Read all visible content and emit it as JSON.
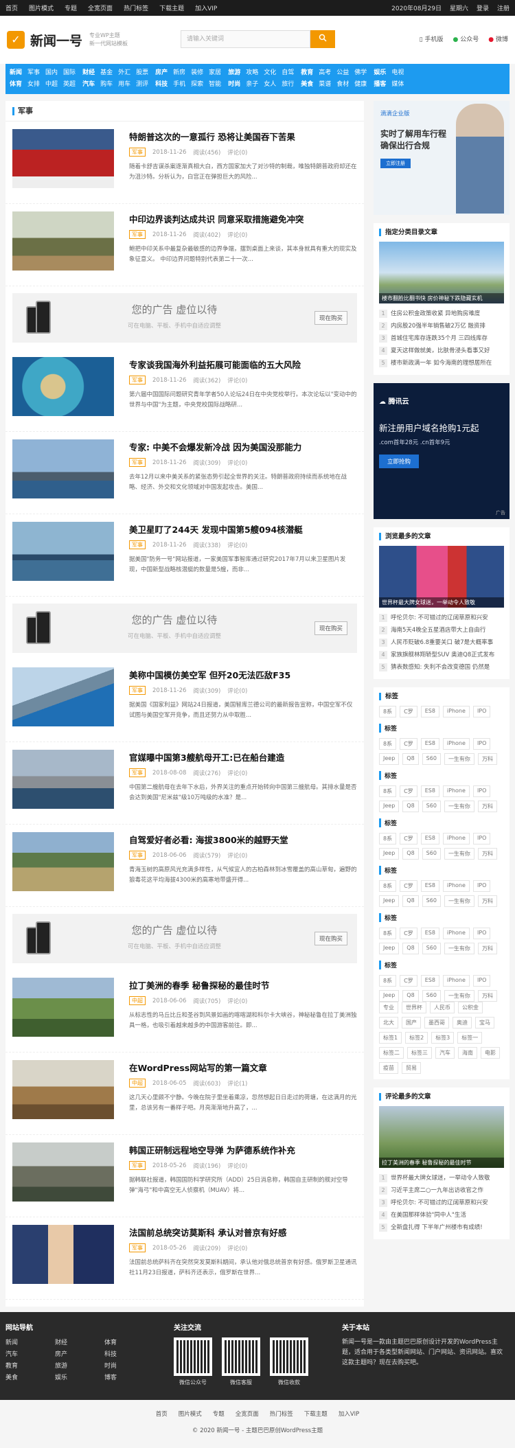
{
  "topbar": {
    "links": [
      "首页",
      "图片模式",
      "专题",
      "全宽页面",
      "热门标签",
      "下载主题",
      "加入VIP"
    ],
    "date": "2020年08月29日",
    "weekday": "星期六",
    "login": "登录",
    "register": "注册"
  },
  "header": {
    "logo": "新闻一号",
    "logo_icon": "✓",
    "sub1": "专业WP主题",
    "sub2": "新一代网站模板",
    "search_placeholder": "请输入关键词",
    "search_icon": "search-icon",
    "mobile": "手机版",
    "official": "公众号",
    "weibo": "微博"
  },
  "nav": [
    [
      "新闻",
      "军事",
      "国内",
      "国际",
      "体育",
      "女排",
      "中超",
      "英超"
    ],
    [
      "财经",
      "基金",
      "外汇",
      "股票",
      "汽车",
      "购车",
      "用车",
      "测评"
    ],
    [
      "房产",
      "新房",
      "装修",
      "家居",
      "科技",
      "手机",
      "探索",
      "智能"
    ],
    [
      "旅游",
      "攻略",
      "文化",
      "自驾",
      "时尚",
      "亲子",
      "女人",
      "旅行"
    ],
    [
      "教育",
      "高考",
      "公益",
      "佛学",
      "美食",
      "菜谱",
      "食材",
      "健康"
    ],
    [
      "娱乐",
      "电视",
      "播客",
      "媒体"
    ]
  ],
  "section": "军事",
  "articles": [
    {
      "title": "特朗普这次的一意孤行 恐将让美国吞下苦果",
      "tag": "军事",
      "date": "2018-11-26",
      "views": "阅读(456)",
      "comments": "评论(0)",
      "desc": "随着卡舒吉谋杀案逐渐真相大白，西方国家加大了对沙特的制裁，唯独特朗普政府却还在为沮沙特。分析认为，白宫正在弹担巨大的风险..."
    },
    {
      "title": "中印边界谈判达成共识 同意采取措施避免冲突",
      "tag": "军事",
      "date": "2018-11-26",
      "views": "阅读(402)",
      "comments": "评论(0)",
      "desc": "鲍把中印关系中最复杂最敏感的边界争端，摆到桌面上来谈，其本身就具有重大的现实及象征意义。 中印边界问题特别代表第二十一次..."
    },
    {
      "title": "专家谈我国海外利益拓展可能面临的五大风险",
      "tag": "军事",
      "date": "2018-11-26",
      "views": "阅读(362)",
      "comments": "评论(0)",
      "desc": "第六届中国国际问题研究青年学者50人论坛24日在中央党校举行。本次论坛以\"变动中的世界与中国\"为主题，中央党校国际战略研..."
    },
    {
      "title": "专家: 中美不会爆发新冷战 因为美国没那能力",
      "tag": "军事",
      "date": "2018-11-26",
      "views": "阅读(309)",
      "comments": "评论(0)",
      "desc": "去年12月以来中美关系的紧张态势引起全世界的关注。特朗普政府持续而系统地在战略、经济、外交和文化领域对中国发起攻击。美国..."
    },
    {
      "title": "美卫星盯了244天 发现中国第5艘094核潜艇",
      "tag": "军事",
      "date": "2018-11-26",
      "views": "阅读(338)",
      "comments": "评论(0)",
      "desc": "据美国\"防务一号\"网站报道，一家美国军事智库通过研究2017年7月以来卫星图片发现，中国新型战略核潜艇的数量是5艘，而非..."
    },
    {
      "title": "美称中国模仿美空军 但歼20无法匹敌F35",
      "tag": "军事",
      "date": "2018-11-26",
      "views": "阅读(309)",
      "comments": "评论(0)",
      "desc": "据美国《国家利益》网站24日报道，美国智库兰德公司的最新报告宣称，中国空军不仅试图与美国空军开竞争，而且还努力从中取胜..."
    },
    {
      "title": "官媒曝中国第3艘航母开工:已在船台建造",
      "tag": "军事",
      "date": "2018-08-08",
      "views": "阅读(276)",
      "comments": "评论(0)",
      "desc": "中国第二艘航母在去年下水后，外界关注的重点开始转向中国第三艘航母。其排水量是否会达到美国\"尼米兹\"级10万吨级的水准？是..."
    },
    {
      "title": "自驾爱好者必看: 海拔3800米的越野天堂",
      "tag": "军事",
      "date": "2018-06-06",
      "views": "阅读(579)",
      "comments": "评论(0)",
      "desc": "青海玉树的高原风光充满多样性，从气候宜人的古柏森林到冰雪覆盖的高山草甸，遍野的狼毒花这平均海拔4300米的高寒地带盛开得..."
    },
    {
      "title": "拉丁美洲的春季 秘鲁探秘的最佳时节",
      "tag": "中超",
      "date": "2018-06-06",
      "views": "阅读(705)",
      "comments": "评论(0)",
      "desc": "从标志性的马丘比丘和圣谷到风景如画的喀喀湖和科尔卡大峡谷，神秘秘鲁在拉丁美洲独具一格，也吸引着越来越多的中国游客前往。即..."
    },
    {
      "title": "在WordPress网站写的第一篇文章",
      "tag": "中超",
      "date": "2018-06-05",
      "views": "阅读(603)",
      "comments": "评论(1)",
      "desc": "这几天心里颇不宁静。今晚在院子里坐着乘凉，忽然想起日日走过的荷塘，在这满月的光里，总该另有一番样子吧。月亮渐渐地升高了，..."
    },
    {
      "title": "韩国正研制远程地空导弹 为萨德系统作补充",
      "tag": "军事",
      "date": "2018-05-26",
      "views": "阅读(196)",
      "comments": "评论(0)",
      "desc": "据韩联社报道，韩国国防科学研究所（ADD）25日消息称，韩国自主研制的舰对空导弹\"海弓\"和中高空无人侦察机（MUAV）将..."
    },
    {
      "title": "法国前总统突访莫斯科 承认对普京有好感",
      "tag": "军事",
      "date": "2018-05-26",
      "views": "阅读(209)",
      "comments": "评论(0)",
      "desc": "法国前总统萨科齐在突然突发莫斯科期间，承认他对俄总统普京有好感。俄罗斯卫星通讯社11月23日报道，萨科齐还表示，俄罗斯在世界..."
    }
  ],
  "ad": {
    "title": "您的广告 虚位以待",
    "sub": "可在电脑、平板、手机中自适应调整",
    "button": "现在购买"
  },
  "sidebar": {
    "ad1": {
      "brand": "滴滴企业版",
      "line1": "实时了解用车行程",
      "line2": "确保出行合规",
      "btn": "立即注册"
    },
    "cat_title": "指定分类目录文章",
    "cat_caption": "楼市翻脸比翻书快 房价神秘下跌隐藏玄机",
    "cat_list": [
      "住房公积金政策收紧 异地购房难度",
      "内房股20强半年销售破2万亿 融资排",
      "首城住宅库存连跌35个月 三四线库存",
      "夏天这样做就美，比肤骨浸头看事又好",
      "楼市新政满一年 如今海南的理想居所在"
    ],
    "ad2": {
      "brand": "腾讯云",
      "line1": "新注册用户域名抢购1元起",
      "line2": ".com首年28元 .cn首年9元",
      "btn": "立即抢购",
      "label": "广告"
    },
    "hot_title": "浏览最多的文章",
    "hot_caption": "世界杯最大牌女球迷，一举动令人致敬",
    "hot_list": [
      "呼伦贝尔: 不可错过的辽阔草原和兴安",
      "海南5天4晚全五星酒店带大上自由行",
      "人民币贬破6.8重要关口 破7是大概率事",
      "家族旗舰林翔轿型SUV 奥迪Q8正式发布",
      "猜表数感知: 失利不会改变德国 仍然是"
    ],
    "tag_title": "标签",
    "tags_a": [
      "8系",
      "C罗",
      "ES8",
      "iPhone",
      "IPO"
    ],
    "tags_b": [
      "8系",
      "C罗",
      "ES8",
      "iPhone",
      "IPO",
      "Jeep",
      "Q8",
      "S60",
      "一生有你",
      "万科"
    ],
    "tags_c": [
      "专业",
      "世界杯",
      "人民币",
      "公积金",
      "北大",
      "国产",
      "墨西哥",
      "奥迪",
      "宝马",
      "标签1",
      "标签2",
      "标签3",
      "标签一",
      "标签二",
      "标签三",
      "汽车",
      "海南",
      "电影",
      "疫苗",
      "贸易"
    ],
    "cmt_title": "评论最多的文章",
    "cmt_caption": "拉丁美洲的春季 秘鲁探秘的最佳时节",
    "cmt_list": [
      "世界杯最大牌女球迷，一举动令人致敬",
      "习近平主席二○一九年出访收官之作",
      "呼伦贝尔: 不可错过的辽阔草原和兴安",
      "在美国那样体验\"同中人\"生活",
      "全新盘扎得 下半年广州楼市有成绩!"
    ]
  },
  "footer": {
    "nav_title": "网站导航",
    "links": [
      "新闻",
      "财经",
      "体育",
      "汽车",
      "房产",
      "科技",
      "教育",
      "旅游",
      "时尚",
      "美食",
      "娱乐",
      "博客"
    ],
    "follow_title": "关注交流",
    "qr_labels": [
      "微信公众号",
      "微信客服",
      "微信收款"
    ],
    "about_title": "关于本站",
    "about": "新闻一号是一款由主题巴巴原创设计开发的WordPress主题，适合用于各类型新闻网站、门户网站、资讯网站。喜欢这款主题吗？现在去购买吧。"
  },
  "bottom": {
    "links": [
      "首页",
      "图片模式",
      "专题",
      "全宽页面",
      "热门标签",
      "下载主题",
      "加入VIP"
    ],
    "copyright": "© 2020 新闻一号 - 主题巴巴原创WordPress主题"
  }
}
